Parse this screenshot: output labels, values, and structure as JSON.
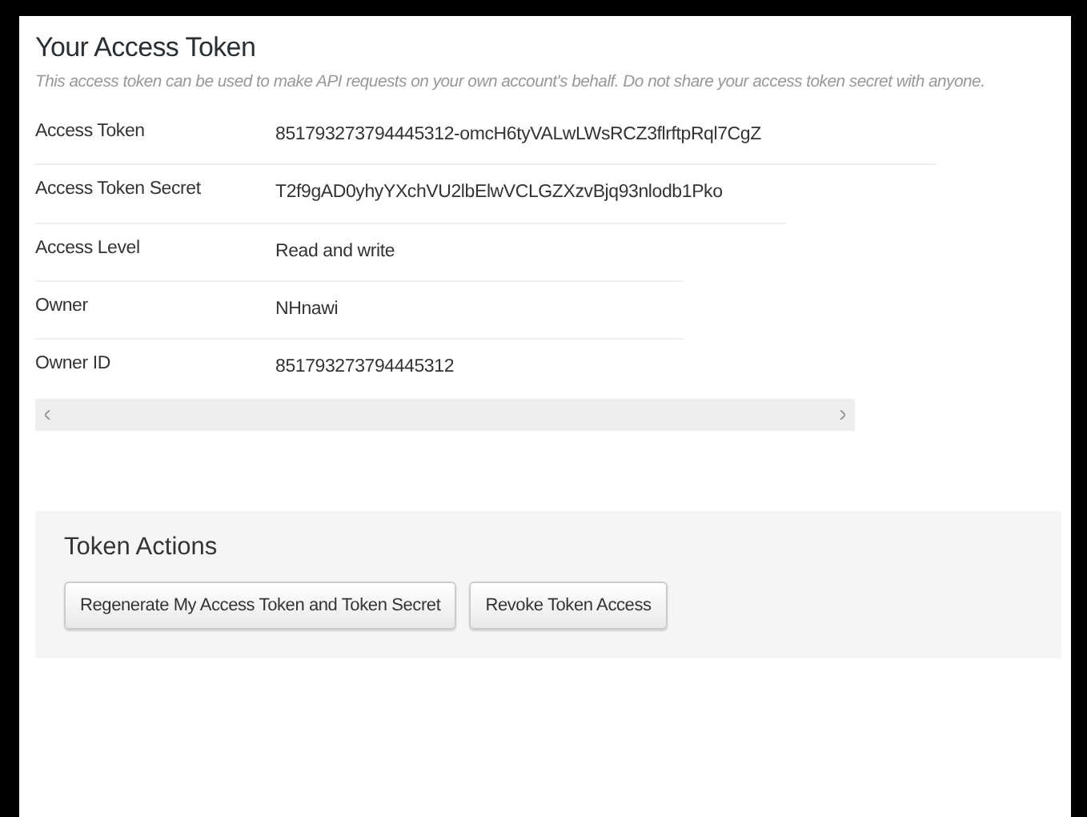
{
  "title": "Your Access Token",
  "description": "This access token can be used to make API requests on your own account's behalf. Do not share your access token secret with anyone.",
  "details": [
    {
      "label": "Access Token",
      "value": "851793273794445312-omcH6tyVALwLWsRCZ3flrftpRql7CgZ"
    },
    {
      "label": "Access Token Secret",
      "value": "T2f9gAD0yhyYXchVU2lbElwVCLGZXzvBjq93nlodb1Pko"
    },
    {
      "label": "Access Level",
      "value": "Read and write"
    },
    {
      "label": "Owner",
      "value": "NHnawi"
    },
    {
      "label": "Owner ID",
      "value": "851793273794445312"
    }
  ],
  "actions": {
    "title": "Token Actions",
    "buttons": [
      "Regenerate My Access Token and Token Secret",
      "Revoke Token Access"
    ]
  }
}
